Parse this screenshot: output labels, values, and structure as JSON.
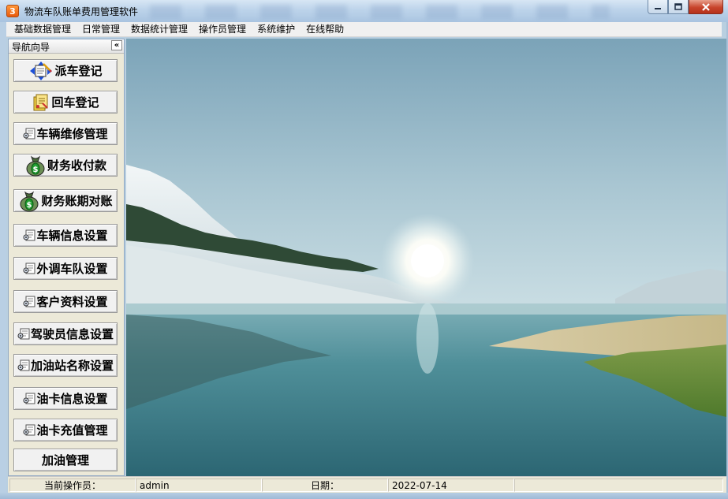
{
  "window": {
    "title": "物流车队账单费用管理软件",
    "app_icon_glyph": "3",
    "controls": [
      "minimize-icon",
      "maximize-icon",
      "close-icon"
    ]
  },
  "menu": {
    "items": [
      "基础数据管理",
      "日常管理",
      "数据统计管理",
      "操作员管理",
      "系统维护",
      "在线帮助"
    ]
  },
  "nav": {
    "title": "导航向导",
    "collapse_label": "«",
    "buttons": [
      {
        "label": "派车登记",
        "icon": "dispatch-icon"
      },
      {
        "label": "回车登记",
        "icon": "return-icon"
      },
      {
        "label": "车辆维修管理",
        "icon": "card-icon"
      },
      {
        "label": "财务收付款",
        "icon": "money-bag-icon"
      },
      {
        "label": "财务账期对账",
        "icon": "money-bag-icon"
      },
      {
        "label": "车辆信息设置",
        "icon": "card-icon"
      },
      {
        "label": "外调车队设置",
        "icon": "card-icon"
      },
      {
        "label": "客户资料设置",
        "icon": "card-icon"
      },
      {
        "label": "驾驶员信息设置",
        "icon": "card-icon"
      },
      {
        "label": "加油站名称设置",
        "icon": "card-icon"
      },
      {
        "label": "油卡信息设置",
        "icon": "card-icon"
      },
      {
        "label": "油卡充值管理",
        "icon": "card-icon"
      },
      {
        "label": "加油管理",
        "icon": ""
      }
    ]
  },
  "status": {
    "operator_label": "当前操作员：",
    "operator_value": "admin",
    "date_label": "日期：",
    "date_value": "2022-07-14"
  },
  "colors": {
    "nav_bg": "#ece9d8",
    "titlebar": "#bcd3ea",
    "close_button": "#c8452c"
  }
}
